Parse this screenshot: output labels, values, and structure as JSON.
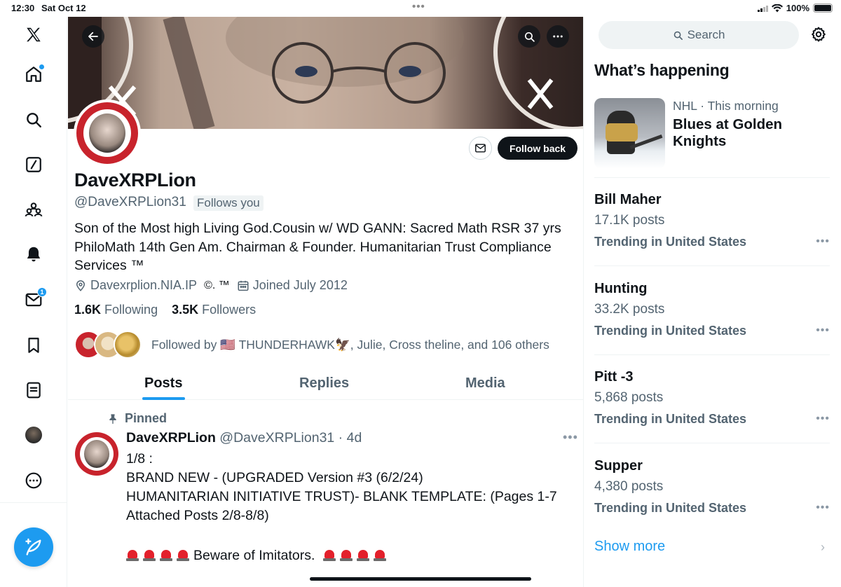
{
  "status_bar": {
    "time": "12:30",
    "date": "Sat Oct 12",
    "battery": "100%"
  },
  "nav": {
    "items": [
      "Home",
      "Explore",
      "Grok",
      "Communities",
      "Notifications",
      "Messages",
      "Bookmarks",
      "Lists",
      "Profile",
      "More"
    ],
    "messages_badge": "1",
    "compose": "Post"
  },
  "profile": {
    "name": "DaveXRPLion",
    "handle": "@DaveXRPLion31",
    "follows_you": "Follows you",
    "bio": "Son of the Most high Living God.Cousin w/ WD GANN: Sacred Math RSR 37 yrs PhiloMath 14th Gen Am. Chairman & Founder. Humanitarian Trust Compliance Services ™",
    "location": "Davexrplion.NIA.IP",
    "extra": "©. ™",
    "joined": "Joined July 2012",
    "following_count": "1.6K",
    "following_label": "Following",
    "followers_count": "3.5K",
    "followers_label": "Followers",
    "followed_by": "Followed by 🇺🇸 THUNDERHAWK🦅, Julie, Cross theline, and 106 others",
    "follow_back": "Follow back"
  },
  "tabs": [
    {
      "label": "Posts",
      "active": true
    },
    {
      "label": "Replies",
      "active": false
    },
    {
      "label": "Media",
      "active": false
    }
  ],
  "pinned_post": {
    "pinned_label": "Pinned",
    "author": "DaveXRPLion",
    "handle_time": "@DaveXRPLion31 · 4d",
    "lines": [
      "1/8 :",
      "BRAND NEW - (UPGRADED Version #3  (6/2/24)",
      "HUMANITARIAN INITIATIVE TRUST)- BLANK TEMPLATE: (Pages 1-7",
      "Attached Posts 2/8-8/8)",
      "",
      "Beware of Imitators."
    ]
  },
  "sidebar": {
    "search_placeholder": "Search",
    "whats_happening": "What’s happening",
    "featured": {
      "category": "NHL",
      "time": " · This morning",
      "title": "Blues at Golden Knights"
    },
    "trends": [
      {
        "name": "Bill Maher",
        "posts": "17.1K posts",
        "location": "Trending in United States"
      },
      {
        "name": "Hunting",
        "posts": "33.2K posts",
        "location": "Trending in United States"
      },
      {
        "name": "Pitt -3",
        "posts": "5,868 posts",
        "location": "Trending in United States"
      },
      {
        "name": "Supper",
        "posts": "4,380 posts",
        "location": "Trending in United States"
      }
    ],
    "show_more": "Show more"
  },
  "colors": {
    "accent": "#1d9bf0",
    "text": "#0f1419",
    "muted": "#536471"
  }
}
